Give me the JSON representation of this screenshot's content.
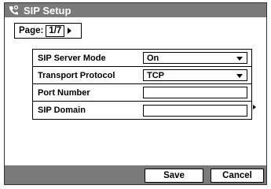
{
  "window": {
    "title": "SIP Setup",
    "title_icon": "phone-settings-icon"
  },
  "pager": {
    "label": "Page:",
    "value": "1/7"
  },
  "form": {
    "rows": [
      {
        "label": "SIP Server Mode",
        "value": "On",
        "type": "select"
      },
      {
        "label": "Transport Protocol",
        "value": "TCP",
        "type": "select"
      },
      {
        "label": "Port Number",
        "value": "",
        "type": "input"
      },
      {
        "label": "SIP Domain",
        "value": "",
        "type": "input"
      }
    ]
  },
  "buttons": {
    "save": "Save",
    "cancel": "Cancel"
  },
  "colors": {
    "bar": "#7a7a7a",
    "text": "#000000",
    "background": "#ffffff"
  }
}
